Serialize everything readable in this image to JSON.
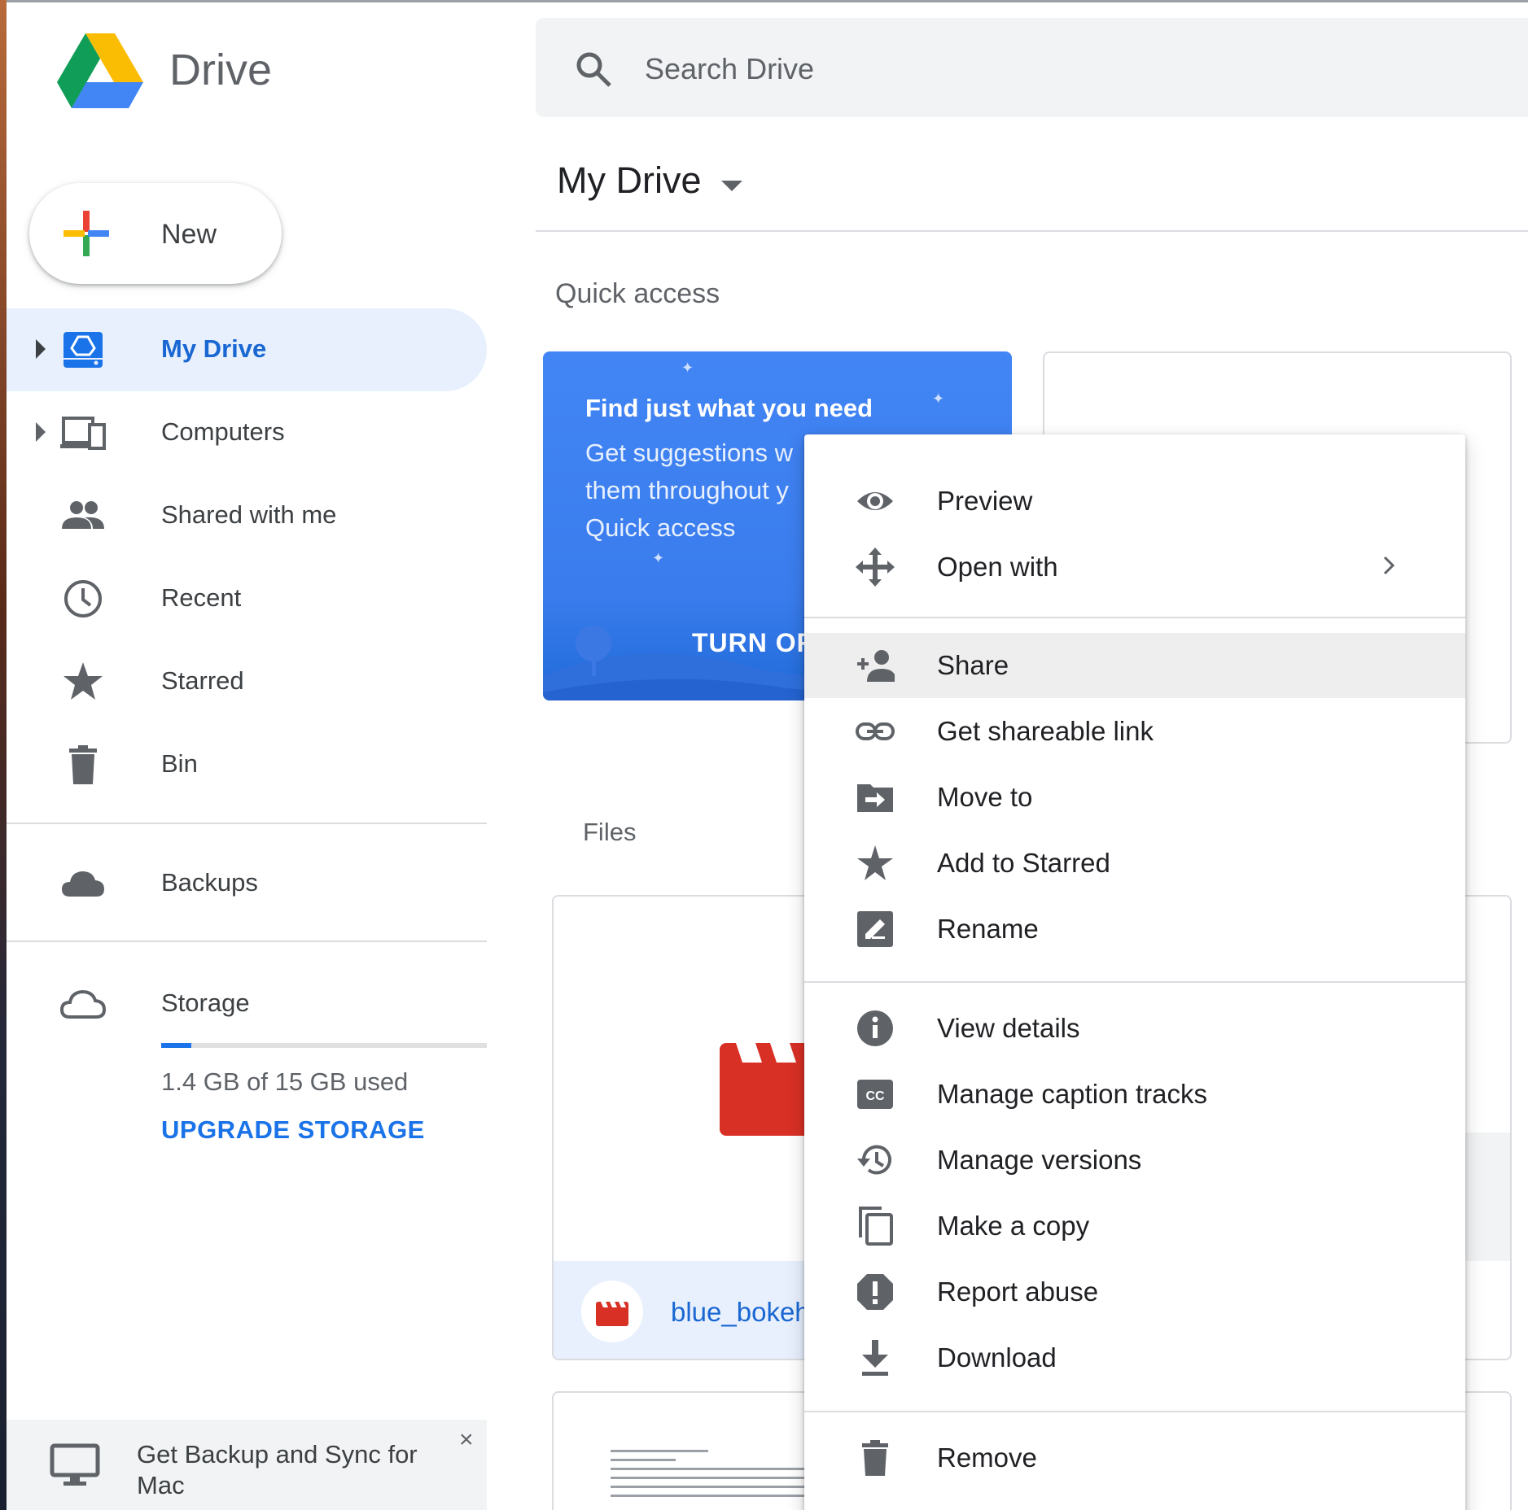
{
  "app": {
    "brand": "Drive"
  },
  "colors": {
    "accent": "#1a73e8",
    "active_bg": "#e8f0fe",
    "quick_access_card": "#4285f4",
    "video_icon": "#d93025"
  },
  "search": {
    "placeholder": "Search Drive",
    "icon": "search-icon"
  },
  "new_button": {
    "label": "New",
    "icon": "plus-icon"
  },
  "sidebar": {
    "items": [
      {
        "label": "My Drive",
        "icon": "my-drive-icon",
        "active": true,
        "expandable": true
      },
      {
        "label": "Computers",
        "icon": "computers-icon",
        "expandable": true
      },
      {
        "label": "Shared with me",
        "icon": "people-icon"
      },
      {
        "label": "Recent",
        "icon": "clock-icon"
      },
      {
        "label": "Starred",
        "icon": "star-icon"
      },
      {
        "label": "Bin",
        "icon": "trash-icon"
      }
    ],
    "backups": {
      "label": "Backups",
      "icon": "cloud-filled-icon"
    },
    "storage": {
      "label": "Storage",
      "icon": "cloud-outline-icon",
      "used_text": "1.4 GB of 15 GB used",
      "used_fraction": 0.093,
      "upgrade_label": "UPGRADE STORAGE"
    },
    "promo": {
      "text": "Get Backup and Sync for Mac",
      "icon": "monitor-icon",
      "close": "×"
    }
  },
  "main": {
    "title": "My Drive",
    "quick_access": {
      "label": "Quick access",
      "card": {
        "heading": "Find just what you need",
        "body": "Get suggestions w them throughout y Quick access",
        "button": "TURN OF"
      }
    },
    "files": {
      "label": "Files",
      "items": [
        {
          "name": "blue_bokeh",
          "type": "video"
        }
      ]
    }
  },
  "context_menu": {
    "groups": [
      [
        {
          "label": "Preview",
          "icon": "eye-icon"
        },
        {
          "label": "Open with",
          "icon": "move-arrows-icon",
          "submenu": true
        }
      ],
      [
        {
          "label": "Share",
          "icon": "add-person-icon",
          "highlighted": true
        },
        {
          "label": "Get shareable link",
          "icon": "link-icon"
        },
        {
          "label": "Move to",
          "icon": "folder-move-icon"
        },
        {
          "label": "Add to Starred",
          "icon": "star-icon"
        },
        {
          "label": "Rename",
          "icon": "rename-icon"
        }
      ],
      [
        {
          "label": "View details",
          "icon": "info-icon"
        },
        {
          "label": "Manage caption tracks",
          "icon": "cc-icon"
        },
        {
          "label": "Manage versions",
          "icon": "history-icon"
        },
        {
          "label": "Make a copy",
          "icon": "copy-icon"
        },
        {
          "label": "Report abuse",
          "icon": "report-icon"
        },
        {
          "label": "Download",
          "icon": "download-icon"
        }
      ],
      [
        {
          "label": "Remove",
          "icon": "trash-icon"
        }
      ]
    ]
  }
}
